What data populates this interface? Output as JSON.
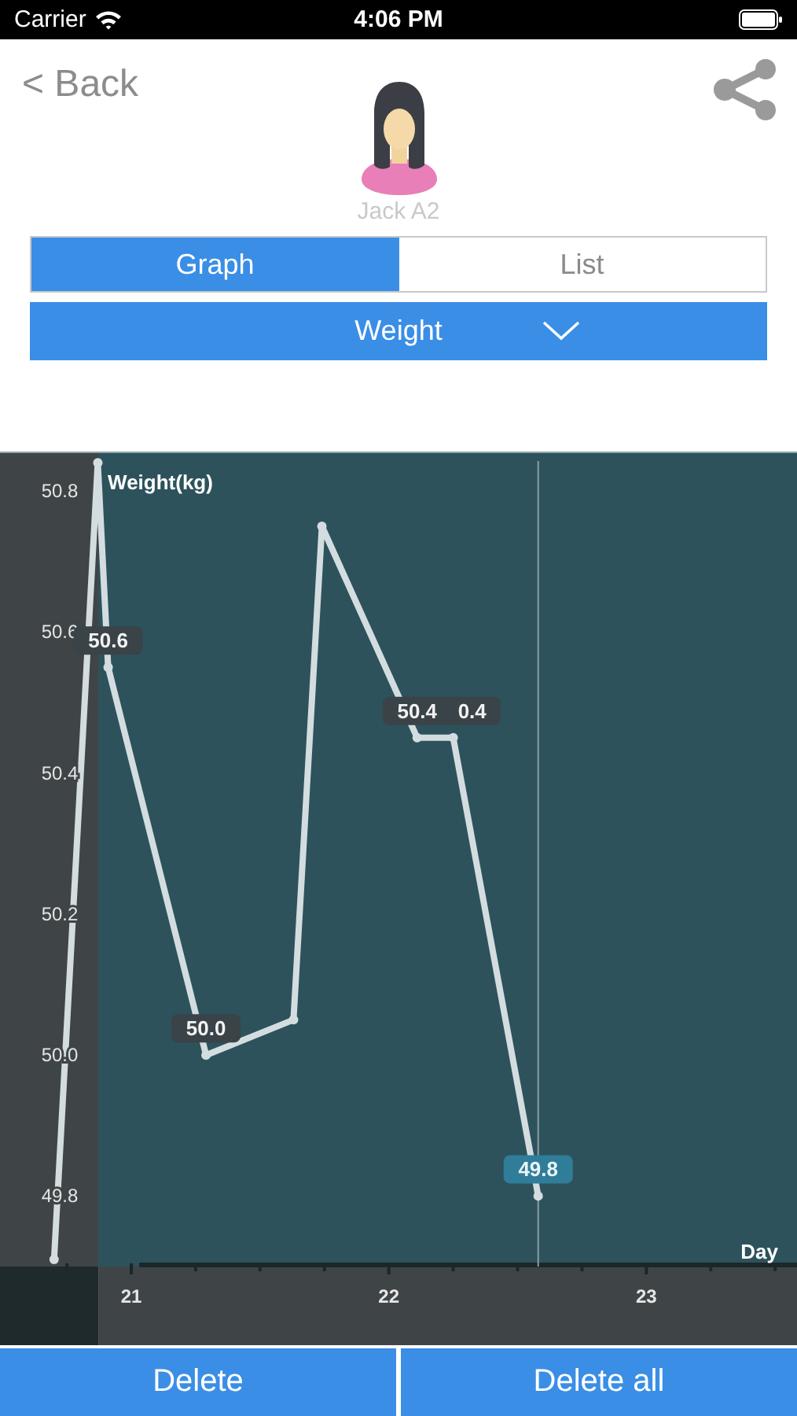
{
  "status_bar": {
    "carrier": "Carrier",
    "time": "4:06 PM"
  },
  "nav": {
    "back": "< Back"
  },
  "profile": {
    "name": "Jack A2"
  },
  "tabs": [
    {
      "label": "Graph",
      "selected": true
    },
    {
      "label": "List",
      "selected": false
    }
  ],
  "dropdown": {
    "value": "Weight"
  },
  "chart": {
    "chart_data": {
      "type": "line",
      "ylabel": "Weight(kg)",
      "xlabel": "Day",
      "x": [
        20.7,
        20.87,
        20.91,
        21.29,
        21.63,
        21.74,
        22.11,
        22.25,
        22.58
      ],
      "series": [
        {
          "color": "#d3dde0",
          "marker": "o",
          "values": [
            49.71,
            50.84,
            50.55,
            50.0,
            50.05,
            50.75,
            50.45,
            50.45,
            49.8
          ]
        }
      ],
      "ref_lines": [
        {
          "axis": "x",
          "value": 22.58
        }
      ],
      "bands": [
        {
          "axis": "x",
          "from": 20.49,
          "to": 20.872,
          "color": "#3f4547"
        }
      ],
      "xlim": [
        20.49,
        23.585
      ],
      "ylim": [
        49.7,
        50.856
      ],
      "xticks": [
        21,
        22,
        23
      ],
      "yticks": [
        {
          "value": 49.8,
          "label": "49.8"
        },
        {
          "value": 50.0,
          "label": "50.0"
        },
        {
          "value": 50.2,
          "label": "50.2"
        },
        {
          "value": 50.4,
          "label": "50.4"
        },
        {
          "value": 50.6,
          "label": "50.6"
        },
        {
          "value": 50.8,
          "label": "50.8"
        }
      ],
      "annotations": [
        {
          "x": 20.91,
          "y": 50.55,
          "text": "50.6"
        },
        {
          "x": 21.29,
          "y": 50.0,
          "text": "50.0"
        },
        {
          "x": 22.11,
          "y": 50.45,
          "text": "50.4"
        },
        {
          "x": 22.25,
          "y": 50.45,
          "text": "0.4"
        },
        {
          "x": 22.58,
          "y": 49.8,
          "text": "49.8"
        }
      ]
    }
  },
  "buttons": [
    {
      "label": "Delete"
    },
    {
      "label": "Delete all"
    }
  ]
}
